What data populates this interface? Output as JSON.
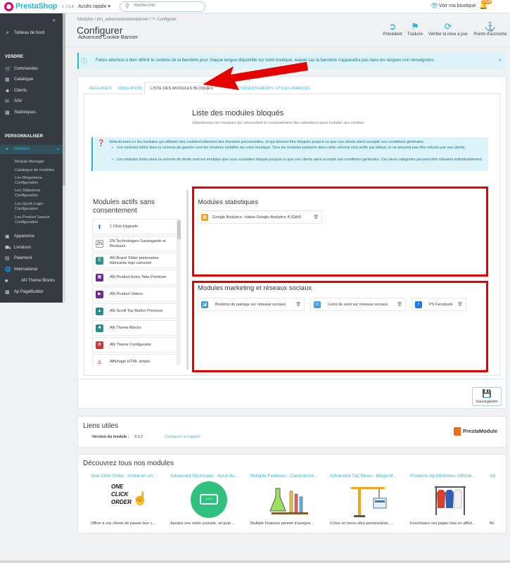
{
  "topbar": {
    "brand": "PrestaShop",
    "version": "1.7.6.8",
    "quick_access": "Accès rapide ▾",
    "search_placeholder": "Rechercher",
    "shop_link": "Voir ma boutique",
    "notif_badge": "2 5 8"
  },
  "sidebar": {
    "dashboard": "Tableau de bord",
    "sections": {
      "sell": "VENDRE",
      "customize": "PERSONNALISER"
    },
    "sell_items": [
      "Commandes",
      "Catalogue",
      "Clients",
      "SAV",
      "Statistiques"
    ],
    "modules": "Modules",
    "module_subitems": [
      "Module Manager",
      "Catalogue de modules",
      "Leo Megamenu Configuration",
      "Leo Slideshow Configuration",
      "Leo Quick Login Configuration",
      "Leo Product Search Configuration"
    ],
    "other_items": [
      "Apparence",
      "Livraison",
      "Paiement",
      "International",
      "AN Theme Blocks",
      "Ap PageBuilder"
    ]
  },
  "header": {
    "breadcrumb": "Modules  /  pm_advancedcookiebanner  /  ✎ Configurer",
    "title": "Configurer",
    "subtitle": "Advanced Cookie Banner",
    "toolbar": [
      "Précédent",
      "Traduire",
      "Vérifier la mise à jour",
      "Points d'accroche"
    ]
  },
  "alert_top": "Faites attention à bien définir le contenu de la bannière pour chaque langue disponible sur votre boutique, auquel cas la bannière n'apparaîtra pas dans les langues non renseignées.",
  "tabs": [
    "RÉGLAGES",
    "SIMULATION",
    "LISTE DES MODULES BLOQUÉS",
    "CONSENTEMENTS",
    "STYLES AVANCÉS"
  ],
  "main": {
    "title": "Liste des modules bloqués",
    "subtitle": "Sélectionnez les modules qui nécessitent le consentement des utilisateurs pour installer des cookies",
    "info_main": "Sélectionnez ici les modules qui utilisent des cookies/collectent des données personnelles, et qui doivent être bloqués jusqu'à ce que vos clients aient accepté vos conditions générales.",
    "info_bullets": [
      "Les modules listés dans la colonne de gauche sont les modules installés sur votre boutique. Tous les modules présents dans cette colonne sont actifs par défaut, et ne peuvent pas être refusés par vos clients.",
      "Les modules listés dans la colonne de droite sont les modules que vous souhaitez bloquer jusqu'à ce que vos clients aient accepté vos conditions générales. Ces deux catégories peuvent être refusées individuellement."
    ],
    "left_title": "Modules actifs sans consentement",
    "left_modules": [
      "1-Click Upgrade",
      "ZN Technologies Sauvegarde et Restaure",
      "AN Brand Slider partenaires fabricants logo carousel",
      "AN Product Extra Tabs Premium",
      "AN Product Videos",
      "AN Scroll Top Button Premium",
      "AN Theme Blocks",
      "AN Theme Configurator",
      "Affichage HTML simple"
    ],
    "stats_title": "Modules statistiques",
    "stats_modules": [
      "Google Analytics : balise Google-Analytics 4 (GA4)"
    ],
    "marketing_title": "Modules marketing et réseaux sociaux",
    "marketing_modules": [
      "Boutons de partage sur réseaux sociaux",
      "Liens de suivi sur réseaux sociaux",
      "PS Facebook"
    ],
    "save": "Sauvegarder"
  },
  "links": {
    "title": "Liens utiles",
    "version_label": "Version du module :",
    "version": "3.0.2",
    "contact": "Contacter le support",
    "brand": "PrestaModule"
  },
  "discover": {
    "title": "Découvrez tous nos modules",
    "items": [
      {
        "name": "One Click Order - Achat en un ...",
        "desc": "Offrez à vos clients de passer leur c..."
      },
      {
        "name": "Advanced Shortcode - Ajout de...",
        "desc": "Ajoutez une vidéo youtube, un post ..."
      },
      {
        "name": "Multiple Features - Caractéristi...",
        "desc": "Multiple Features permet d'assigne..."
      },
      {
        "name": "Advanced Top Menu - Mega M...",
        "desc": "Créez un menu ultra personnalisé, ..."
      },
      {
        "name": "Products by Attributes: Affiche...",
        "desc": "Enrichissez vos pages liste en affich..."
      },
      {
        "name": "Ad",
        "desc": "Bo"
      }
    ],
    "one_click_art": [
      "ONE",
      "CLICK",
      "ORDER"
    ]
  }
}
